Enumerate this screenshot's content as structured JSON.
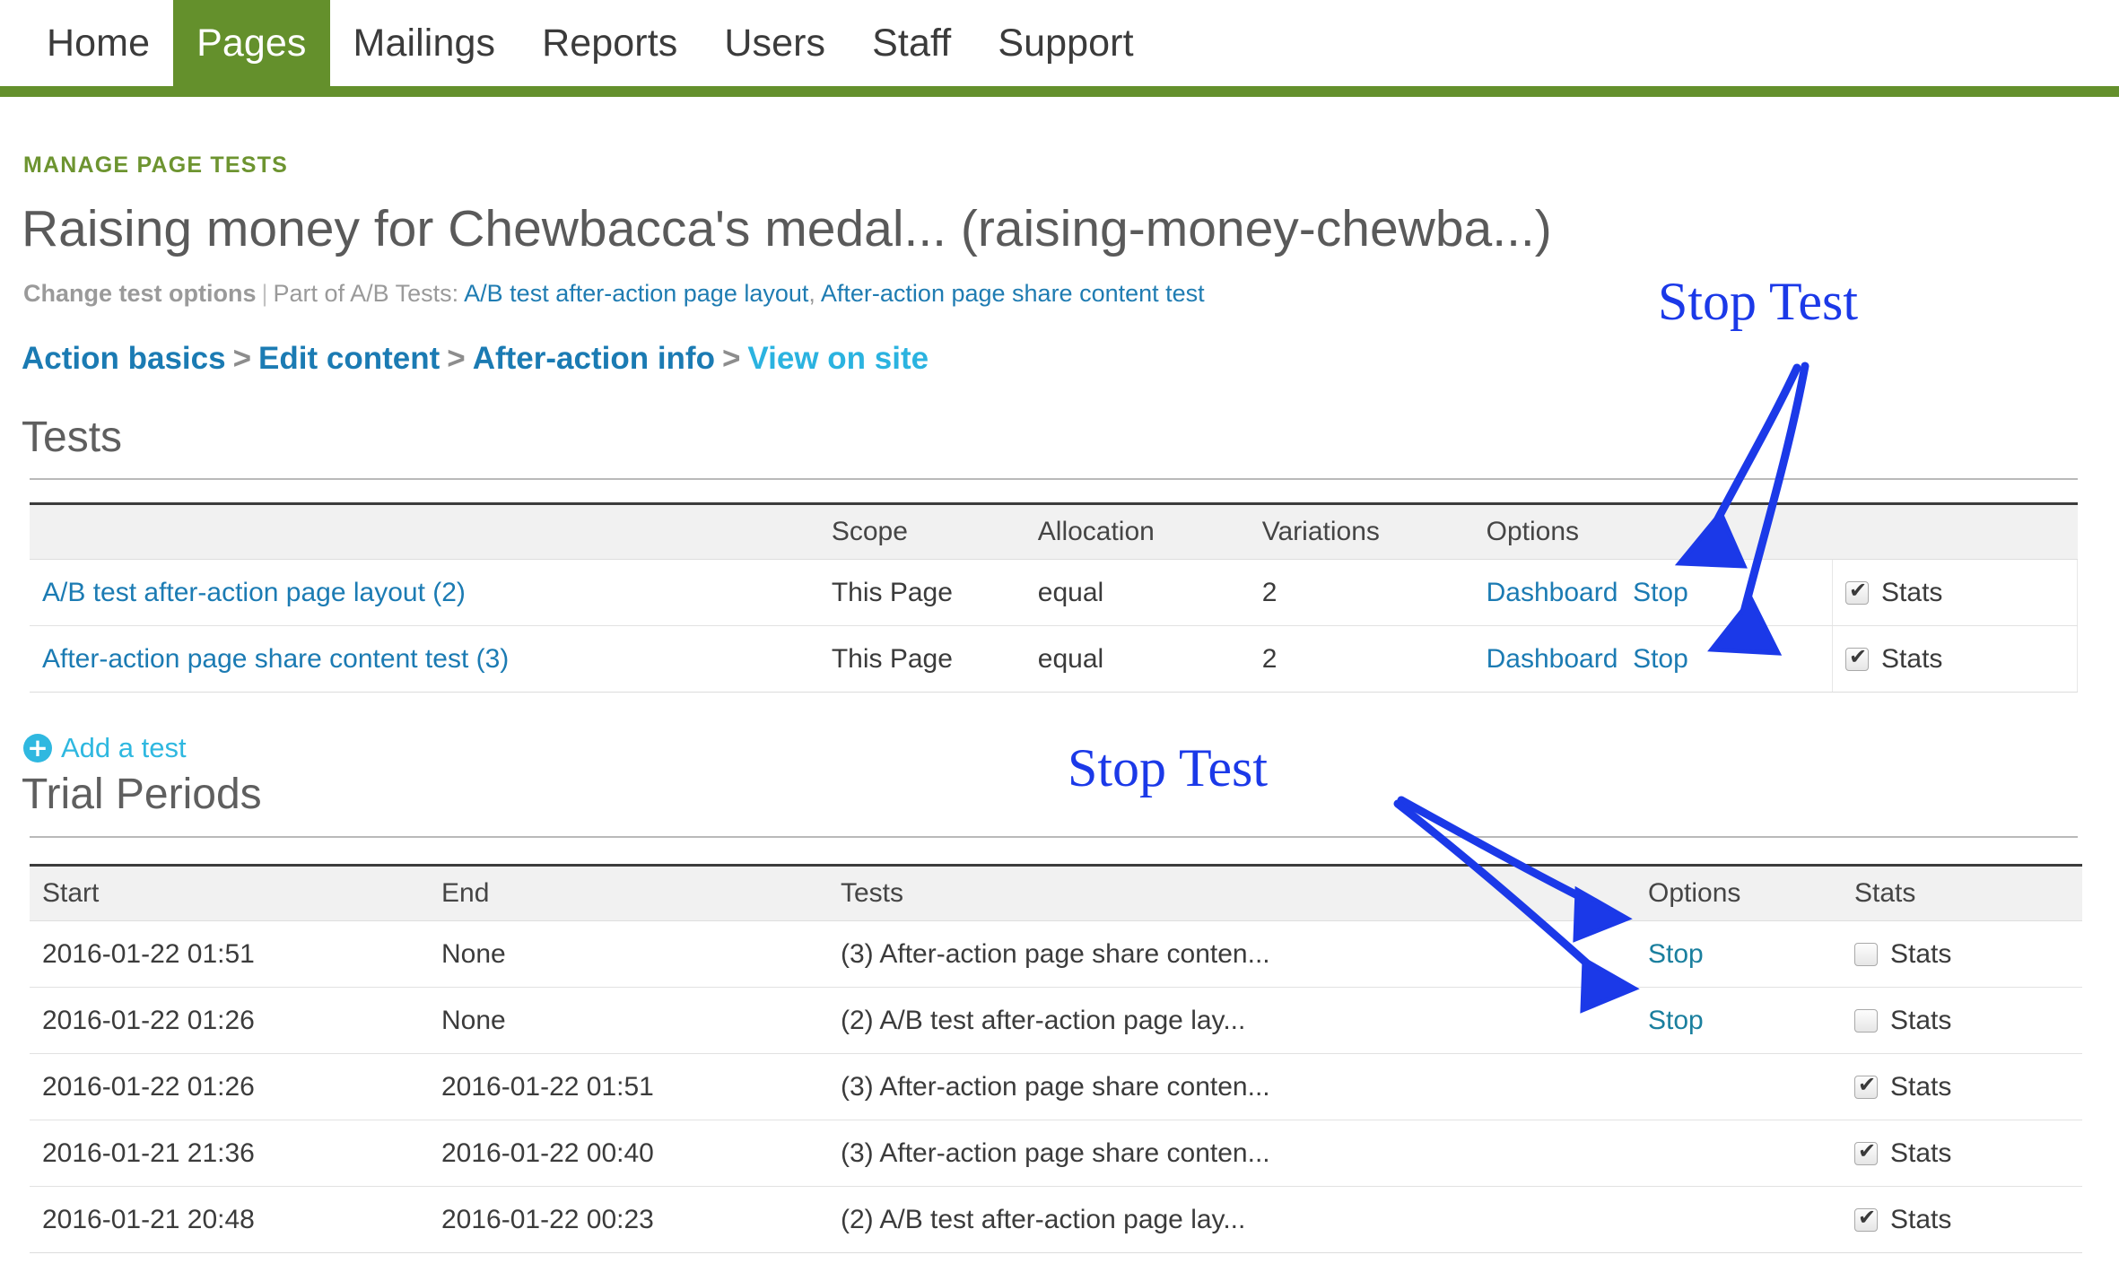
{
  "nav": {
    "items": [
      {
        "label": "Home",
        "active": false
      },
      {
        "label": "Pages",
        "active": true
      },
      {
        "label": "Mailings",
        "active": false
      },
      {
        "label": "Reports",
        "active": false
      },
      {
        "label": "Users",
        "active": false
      },
      {
        "label": "Staff",
        "active": false
      },
      {
        "label": "Support",
        "active": false
      }
    ],
    "accent_color": "#64902c"
  },
  "header": {
    "eyebrow": "MANAGE PAGE TESTS",
    "title": "Raising money for Chewbacca's medal... (raising-money-chewba...)",
    "subline": {
      "change_options": "Change test options",
      "separator": "|",
      "prefix": "Part of A/B Tests:",
      "links": [
        "A/B test after-action page layout",
        "After-action page share content test"
      ],
      "link_separator": ", "
    },
    "breadcrumb": {
      "separator": ">",
      "items": [
        {
          "label": "Action basics",
          "style": "dark"
        },
        {
          "label": "Edit content",
          "style": "dark"
        },
        {
          "label": "After-action info",
          "style": "dark"
        },
        {
          "label": "View on site",
          "style": "light"
        }
      ]
    }
  },
  "tests_section": {
    "heading": "Tests",
    "columns": [
      "",
      "Scope",
      "Allocation",
      "Variations",
      "Options",
      ""
    ],
    "rows": [
      {
        "name": "A/B test after-action page layout (2)",
        "scope": "This Page",
        "allocation": "equal",
        "variations": "2",
        "options": [
          "Dashboard",
          "Stop"
        ],
        "stats_label": "Stats",
        "stats_checked": true
      },
      {
        "name": "After-action page share content test (3)",
        "scope": "This Page",
        "allocation": "equal",
        "variations": "2",
        "options": [
          "Dashboard",
          "Stop"
        ],
        "stats_label": "Stats",
        "stats_checked": true
      }
    ],
    "add_test_label": "Add a test",
    "add_test_icon": "plus-circle-icon"
  },
  "trial_section": {
    "heading": "Trial Periods",
    "columns": [
      "Start",
      "End",
      "Tests",
      "Options",
      "Stats"
    ],
    "rows": [
      {
        "start": "2016-01-22 01:51",
        "end": "None",
        "tests": "(3) After-action page share conten...",
        "option": "Stop",
        "stats_label": "Stats",
        "stats_checked": false
      },
      {
        "start": "2016-01-22 01:26",
        "end": "None",
        "tests": "(2) A/B test after-action page lay...",
        "option": "Stop",
        "stats_label": "Stats",
        "stats_checked": false
      },
      {
        "start": "2016-01-22 01:26",
        "end": "2016-01-22 01:51",
        "tests": "(3) After-action page share conten...",
        "option": "",
        "stats_label": "Stats",
        "stats_checked": true
      },
      {
        "start": "2016-01-21 21:36",
        "end": "2016-01-22 00:40",
        "tests": "(3) After-action page share conten...",
        "option": "",
        "stats_label": "Stats",
        "stats_checked": true
      },
      {
        "start": "2016-01-21 20:48",
        "end": "2016-01-22 00:23",
        "tests": "(2) A/B test after-action page lay...",
        "option": "",
        "stats_label": "Stats",
        "stats_checked": true
      }
    ]
  },
  "annotations": {
    "color": "#1b39e8",
    "items": [
      {
        "label": "Stop Test",
        "target": "tests-table-stop-links"
      },
      {
        "label": "Stop Test",
        "target": "trial-table-stop-links"
      }
    ]
  }
}
